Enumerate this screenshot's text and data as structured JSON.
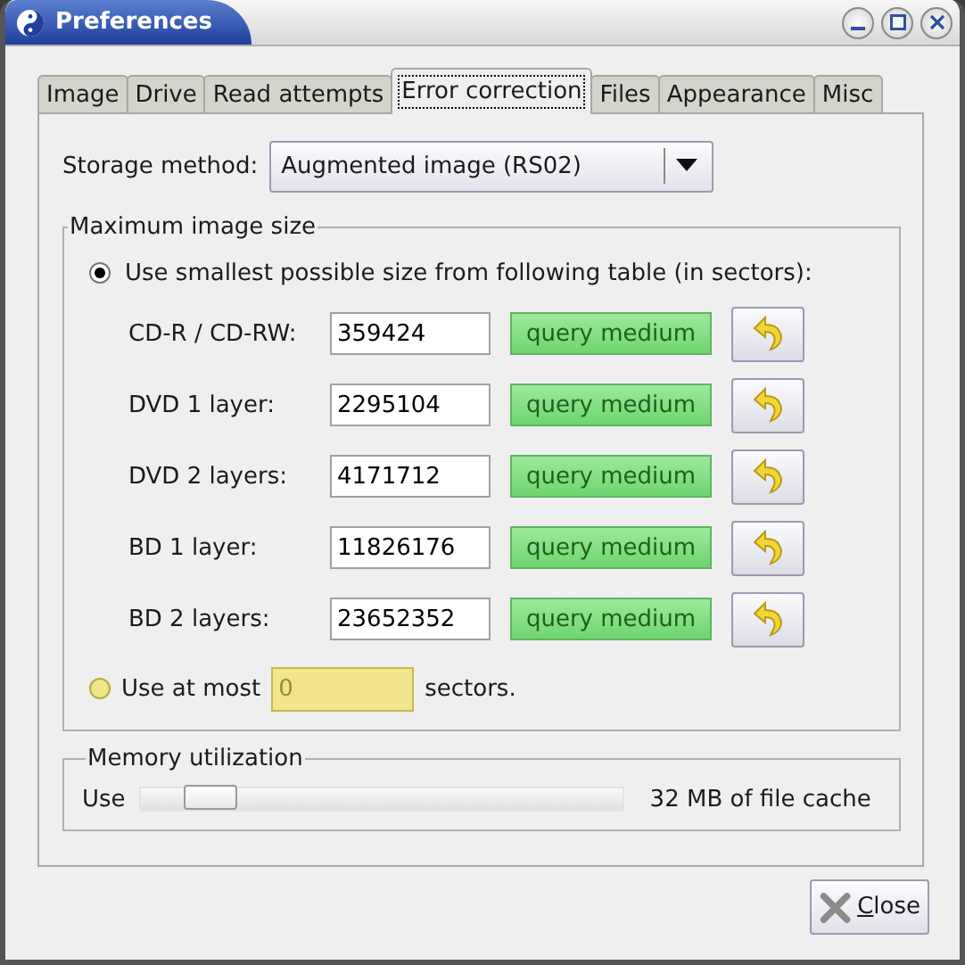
{
  "window": {
    "title": "Preferences"
  },
  "tabs": [
    {
      "label": "Image",
      "selected": false
    },
    {
      "label": "Drive",
      "selected": false
    },
    {
      "label": "Read attempts",
      "selected": false
    },
    {
      "label": "Error correction",
      "selected": true
    },
    {
      "label": "Files",
      "selected": false
    },
    {
      "label": "Appearance",
      "selected": false
    },
    {
      "label": "Misc",
      "selected": false
    }
  ],
  "storage_method": {
    "label": "Storage method:",
    "value": "Augmented image (RS02)"
  },
  "max_image_size": {
    "title": "Maximum image size",
    "smallest_option": {
      "label": "Use smallest possible size from following table (in sectors):",
      "selected": true
    },
    "media": [
      {
        "label": "CD-R / CD-RW:",
        "value": "359424",
        "button": "query medium"
      },
      {
        "label": "DVD 1 layer:",
        "value": "2295104",
        "button": "query medium"
      },
      {
        "label": "DVD 2 layers:",
        "value": "4171712",
        "button": "query medium"
      },
      {
        "label": "BD 1 layer:",
        "value": "11826176",
        "button": "query medium"
      },
      {
        "label": "BD 2 layers:",
        "value": "23652352",
        "button": "query medium"
      }
    ],
    "at_most_option": {
      "label": "Use at most",
      "selected": false,
      "value": "0",
      "disabled": true,
      "suffix": "sectors."
    }
  },
  "memory": {
    "title": "Memory utilization",
    "label": "Use",
    "level": 0.1,
    "reading": "32 MB of file cache"
  },
  "buttons": [
    {
      "label": "Close",
      "kind": "close"
    }
  ]
}
